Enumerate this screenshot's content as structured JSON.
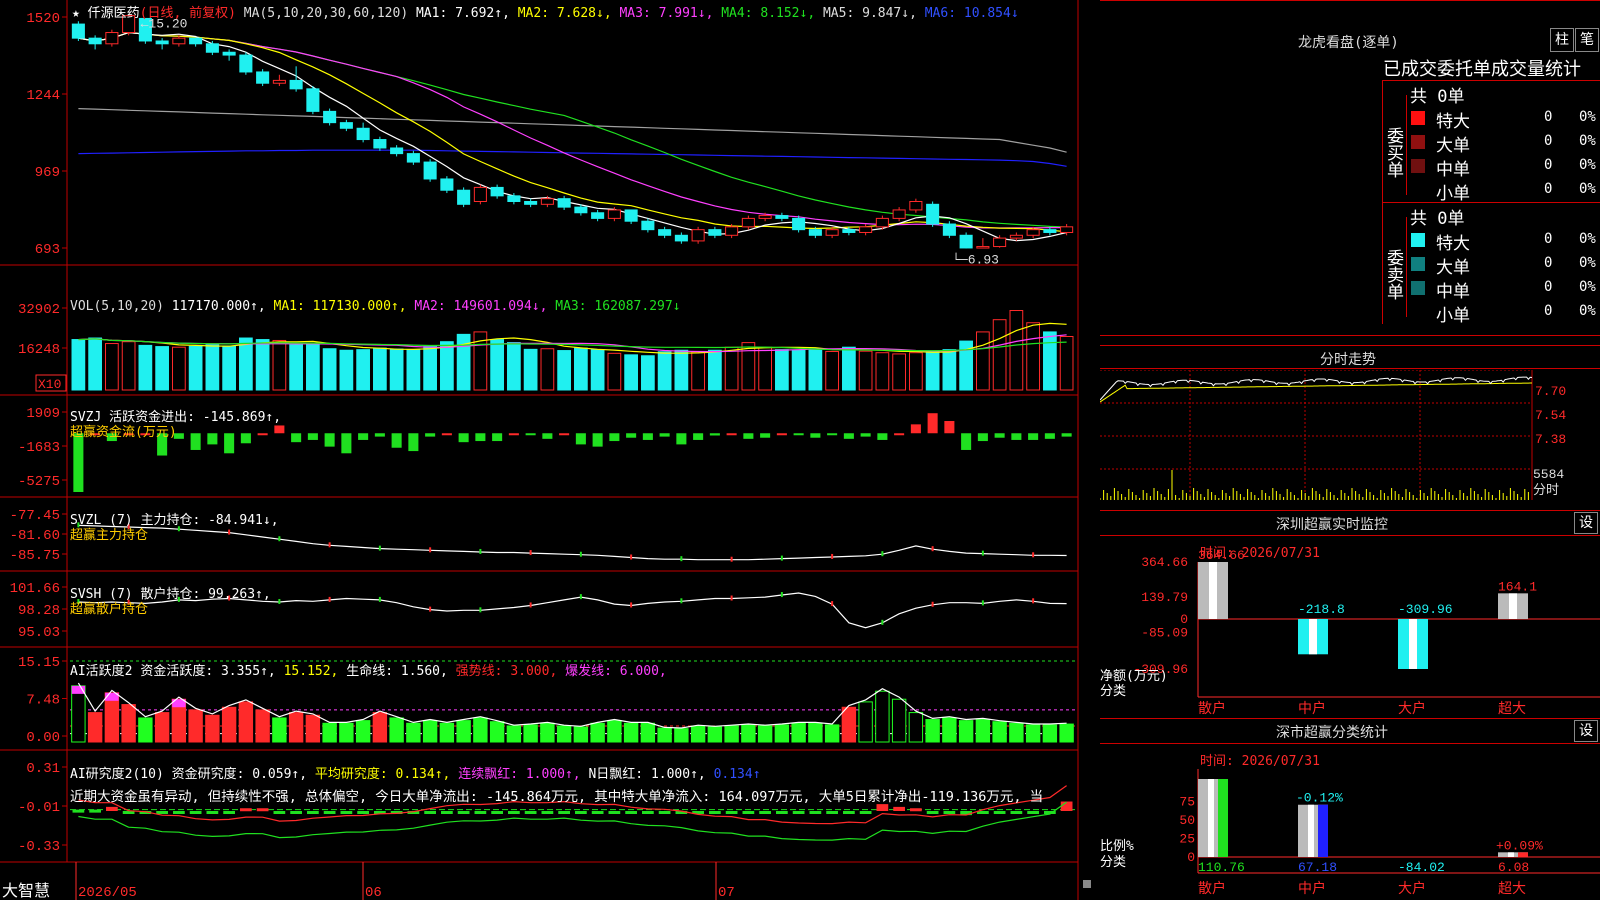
{
  "stock": {
    "name": "★ 仟源医药",
    "mode": "(日线, 前复权)",
    "low_label": "6.93",
    "high_label": "15.20"
  },
  "colors": {
    "up": "#ff2a2a",
    "down": "#20f0f0",
    "bg": "#000000",
    "grid": "#c00000",
    "ma5": "#ffffff",
    "ma10": "#ffff00",
    "ma20": "#ff40ff",
    "ma30": "#20e020",
    "ma60": "#a0a0a0",
    "ma120": "#2020ff",
    "label": "#ffcc00"
  },
  "main": {
    "y_ticks": [
      "1520",
      "1244",
      "969",
      "693"
    ],
    "header": [
      {
        "t": "MA(5,10,20,30,60,120)",
        "c": "#dddddd"
      },
      {
        "t": "MA1: 7.692↑,",
        "c": "#ffffff"
      },
      {
        "t": "MA2: 7.628↓,",
        "c": "#ffff00"
      },
      {
        "t": "MA3: 7.991↓,",
        "c": "#ff40ff"
      },
      {
        "t": "MA4: 8.152↓,",
        "c": "#20e020"
      },
      {
        "t": "MA5: 9.847↓,",
        "c": "#dddddd"
      },
      {
        "t": "MA6: 10.854↓",
        "c": "#3050ff"
      }
    ]
  },
  "vol": {
    "y_ticks": [
      "32902",
      "16248"
    ],
    "multiplier": "X10",
    "header": [
      {
        "t": "VOL(5,10,20)",
        "c": "#dddddd"
      },
      {
        "t": "117170.000↑,",
        "c": "#ffffff"
      },
      {
        "t": "MA1: 117130.000↑,",
        "c": "#ffff00"
      },
      {
        "t": "MA2: 149601.094↓,",
        "c": "#ff40ff"
      },
      {
        "t": "MA3: 162087.297↓",
        "c": "#20e020"
      }
    ]
  },
  "svzj": {
    "y_ticks": [
      "1909",
      "-1683",
      "-5275"
    ],
    "header": [
      {
        "t": "SVZJ  活跃资金进出: -145.869↑,",
        "c": "#ffffff"
      }
    ],
    "sub": "超赢资金流(万元)"
  },
  "svzl": {
    "y_ticks": [
      "-77.45",
      "-81.60",
      "-85.75"
    ],
    "header": [
      {
        "t": "SVZL (7) 主力持仓: -84.941↓,",
        "c": "#ffffff"
      }
    ],
    "sub": "超赢主力持仓"
  },
  "svsh": {
    "y_ticks": [
      "101.66",
      "98.28",
      "95.03"
    ],
    "header": [
      {
        "t": "SVSH (7) 散户持仓: 99.263↑,",
        "c": "#ffffff"
      }
    ],
    "sub": "超赢散户持仓"
  },
  "ai1": {
    "y_ticks": [
      "15.15",
      "7.48",
      "0.00"
    ],
    "header": [
      {
        "t": "AI活跃度2",
        "c": "#ffffff"
      },
      {
        "t": "资金活跃度: 3.355↑,",
        "c": "#ffffff"
      },
      {
        "t": "15.152,",
        "c": "#ffff00"
      },
      {
        "t": "生命线: 1.560,",
        "c": "#ffffff"
      },
      {
        "t": "强势线: 3.000,",
        "c": "#ff2a2a"
      },
      {
        "t": "爆发线: 6.000,",
        "c": "#ff40ff"
      }
    ]
  },
  "ai2": {
    "y_ticks": [
      "0.31",
      "-0.01",
      "-0.33"
    ],
    "header": [
      {
        "t": "AI研究度2(10)",
        "c": "#ffffff"
      },
      {
        "t": "资金研究度: 0.059↑,",
        "c": "#ffffff"
      },
      {
        "t": "平均研究度: 0.134↑,",
        "c": "#ffff00"
      },
      {
        "t": "连续飘红: 1.000↑,",
        "c": "#ff40ff"
      },
      {
        "t": "N日飘红: 1.000↑,",
        "c": "#ffffff"
      },
      {
        "t": "0.134↑",
        "c": "#3050ff"
      }
    ],
    "comment": "近期大资金虽有异动, 但持续性不强, 总体偏空, 今日大单净流出: -145.864万元, 其中特大单净流入: 164.097万元, 大单5日累计净出-119.136万元, 当"
  },
  "xaxis": {
    "brand": "大智慧",
    "labels": [
      "2026/05",
      "06",
      "07"
    ]
  },
  "lhb": {
    "title": "龙虎看盘(逐单)",
    "btn_bar": "柱",
    "btn_list": "笔",
    "subtitle": "已成交委托单成交量统计",
    "buy": {
      "label": "委买单",
      "total": "共 0单",
      "rows": [
        {
          "name": "特大",
          "count": "0",
          "pct": "0%",
          "color": "#ff1010"
        },
        {
          "name": "大单",
          "count": "0",
          "pct": "0%",
          "color": "#901010"
        },
        {
          "name": "中单",
          "count": "0",
          "pct": "0%",
          "color": "#701010"
        },
        {
          "name": "小单",
          "count": "0",
          "pct": "0%",
          "color": "#000000"
        }
      ]
    },
    "sell": {
      "label": "委卖单",
      "total": "共 0单",
      "rows": [
        {
          "name": "特大",
          "count": "0",
          "pct": "0%",
          "color": "#20f0f0"
        },
        {
          "name": "大单",
          "count": "0",
          "pct": "0%",
          "color": "#108080"
        },
        {
          "name": "中单",
          "count": "0",
          "pct": "0%",
          "color": "#107070"
        },
        {
          "name": "小单",
          "count": "0",
          "pct": "0%",
          "color": "#000000"
        }
      ]
    }
  },
  "intraday": {
    "title": "分时走势",
    "y_ticks": [
      "7.70",
      "7.54",
      "7.38"
    ],
    "vol_label": "5584",
    "vol_unit": "分时"
  },
  "monitor": {
    "title": "深圳超赢实时监控",
    "btn": "设",
    "time": "时间: 2026/07/31",
    "y_ticks": [
      "364.66",
      "139.79",
      "0",
      "-85.09",
      "-309.96"
    ],
    "y_unit": "净额(万元)",
    "x_unit": "分类",
    "bars": [
      {
        "cat": "散户",
        "value": 364.66,
        "label": "364.66"
      },
      {
        "cat": "中户",
        "value": -218.8,
        "label": "-218.8"
      },
      {
        "cat": "大户",
        "value": -309.96,
        "label": "-309.96"
      },
      {
        "cat": "超大",
        "value": 164.1,
        "label": "164.1"
      }
    ]
  },
  "classify": {
    "title": "深市超赢分类统计",
    "btn": "设",
    "time": "时间: 2026/07/31",
    "y_ticks": [
      "75",
      "50",
      "25",
      "0"
    ],
    "y_unit": "比例%",
    "x_unit": "分类",
    "bars": [
      {
        "cat": "散户",
        "value": 100,
        "pct": "",
        "amt": "110.76"
      },
      {
        "cat": "中户",
        "value": 67,
        "pct": "-0.12%",
        "amt": "67.18"
      },
      {
        "cat": "大户",
        "value": 0,
        "pct": "",
        "amt": "-84.02"
      },
      {
        "cat": "超大",
        "value": 6,
        "pct": "+0.09%",
        "amt": "6.08"
      }
    ]
  },
  "chart_data": {
    "type": "candlestick",
    "days": 60,
    "x_labels": [
      "2026/05",
      "06",
      "07"
    ],
    "ohlc": [
      [
        14.9,
        14.4,
        15.0,
        14.3
      ],
      [
        14.4,
        14.2,
        14.5,
        14.0
      ],
      [
        14.2,
        14.6,
        14.7,
        14.1
      ],
      [
        14.6,
        15.2,
        15.2,
        14.5
      ],
      [
        15.1,
        14.3,
        15.1,
        14.2
      ],
      [
        14.3,
        14.2,
        14.4,
        14.0
      ],
      [
        14.2,
        14.4,
        14.5,
        14.1
      ],
      [
        14.4,
        14.2,
        14.4,
        14.1
      ],
      [
        14.2,
        13.9,
        14.3,
        13.8
      ],
      [
        13.9,
        13.8,
        14.0,
        13.6
      ],
      [
        13.8,
        13.2,
        13.9,
        13.1
      ],
      [
        13.2,
        12.8,
        13.3,
        12.7
      ],
      [
        12.8,
        12.9,
        13.1,
        12.7
      ],
      [
        12.9,
        12.6,
        13.4,
        12.5
      ],
      [
        12.6,
        11.8,
        12.7,
        11.7
      ],
      [
        11.8,
        11.4,
        11.9,
        11.3
      ],
      [
        11.4,
        11.2,
        11.5,
        11.1
      ],
      [
        11.2,
        10.8,
        11.4,
        10.7
      ],
      [
        10.8,
        10.5,
        10.9,
        10.4
      ],
      [
        10.5,
        10.3,
        10.6,
        10.2
      ],
      [
        10.3,
        10.0,
        10.4,
        9.9
      ],
      [
        10.0,
        9.4,
        10.1,
        9.3
      ],
      [
        9.4,
        9.0,
        9.5,
        8.9
      ],
      [
        9.0,
        8.5,
        9.1,
        8.4
      ],
      [
        8.6,
        9.1,
        9.2,
        8.5
      ],
      [
        9.1,
        8.8,
        9.2,
        8.7
      ],
      [
        8.8,
        8.6,
        8.9,
        8.5
      ],
      [
        8.6,
        8.5,
        8.7,
        8.4
      ],
      [
        8.5,
        8.7,
        8.8,
        8.4
      ],
      [
        8.7,
        8.4,
        8.8,
        8.3
      ],
      [
        8.4,
        8.2,
        8.5,
        8.1
      ],
      [
        8.2,
        8.0,
        8.3,
        7.9
      ],
      [
        8.0,
        8.3,
        8.4,
        7.9
      ],
      [
        8.3,
        7.9,
        8.3,
        7.8
      ],
      [
        7.9,
        7.6,
        8.0,
        7.5
      ],
      [
        7.6,
        7.4,
        7.7,
        7.3
      ],
      [
        7.4,
        7.2,
        7.5,
        7.1
      ],
      [
        7.2,
        7.6,
        7.7,
        7.1
      ],
      [
        7.6,
        7.4,
        7.7,
        7.3
      ],
      [
        7.4,
        7.7,
        7.8,
        7.3
      ],
      [
        7.7,
        8.0,
        8.1,
        7.6
      ],
      [
        8.0,
        8.1,
        8.2,
        7.9
      ],
      [
        8.1,
        8.0,
        8.2,
        7.9
      ],
      [
        8.0,
        7.6,
        8.1,
        7.5
      ],
      [
        7.6,
        7.4,
        7.7,
        7.3
      ],
      [
        7.4,
        7.6,
        7.7,
        7.3
      ],
      [
        7.6,
        7.5,
        7.7,
        7.4
      ],
      [
        7.5,
        7.7,
        7.8,
        7.4
      ],
      [
        7.7,
        8.0,
        8.1,
        7.6
      ],
      [
        8.0,
        8.3,
        8.4,
        7.9
      ],
      [
        8.3,
        8.6,
        8.7,
        8.2
      ],
      [
        8.5,
        7.8,
        8.6,
        7.7
      ],
      [
        7.8,
        7.4,
        7.9,
        7.3
      ],
      [
        7.4,
        6.95,
        7.5,
        6.93
      ],
      [
        7.0,
        7.0,
        7.3,
        6.95
      ],
      [
        7.0,
        7.3,
        7.4,
        6.96
      ],
      [
        7.3,
        7.4,
        7.5,
        7.2
      ],
      [
        7.4,
        7.6,
        7.7,
        7.3
      ],
      [
        7.6,
        7.5,
        7.7,
        7.4
      ],
      [
        7.5,
        7.7,
        7.8,
        7.4
      ]
    ],
    "ma60": [
      11.9,
      11.88,
      11.86,
      11.84,
      11.82,
      11.8,
      11.78,
      11.76,
      11.74,
      11.72,
      11.7,
      11.68,
      11.66,
      11.64,
      11.62,
      11.6,
      11.58,
      11.56,
      11.54,
      11.52,
      11.5,
      11.48,
      11.46,
      11.44,
      11.42,
      11.4,
      11.38,
      11.36,
      11.34,
      11.32,
      11.3,
      11.28,
      11.26,
      11.24,
      11.22,
      11.2,
      11.18,
      11.16,
      11.14,
      11.12,
      11.1,
      11.08,
      11.06,
      11.04,
      11.02,
      11.0,
      10.98,
      10.96,
      10.94,
      10.92,
      10.9,
      10.88,
      10.86,
      10.84,
      10.82,
      10.8,
      10.7,
      10.6,
      10.5,
      10.35
    ],
    "ma120": [
      10.3,
      10.31,
      10.32,
      10.33,
      10.34,
      10.35,
      10.36,
      10.37,
      10.38,
      10.39,
      10.4,
      10.4,
      10.41,
      10.41,
      10.42,
      10.42,
      10.42,
      10.42,
      10.42,
      10.42,
      10.42,
      10.41,
      10.4,
      10.39,
      10.38,
      10.37,
      10.36,
      10.35,
      10.34,
      10.33,
      10.32,
      10.31,
      10.3,
      10.29,
      10.28,
      10.27,
      10.26,
      10.25,
      10.24,
      10.23,
      10.22,
      10.21,
      10.2,
      10.19,
      10.18,
      10.17,
      10.16,
      10.15,
      10.14,
      10.13,
      10.12,
      10.11,
      10.1,
      10.09,
      10.08,
      10.07,
      10.05,
      10.02,
      9.95,
      9.85
    ],
    "volume": [
      16500,
      17000,
      15200,
      15800,
      14600,
      14200,
      14000,
      14300,
      14800,
      14400,
      17000,
      16500,
      16200,
      14800,
      15000,
      13500,
      13000,
      13200,
      13700,
      13400,
      13100,
      14200,
      15800,
      18200,
      19000,
      16500,
      15500,
      13300,
      13500,
      12900,
      13700,
      13200,
      12000,
      11500,
      11200,
      12500,
      13000,
      12500,
      13000,
      14000,
      15500,
      14000,
      13200,
      13000,
      13500,
      12600,
      14000,
      12700,
      12200,
      11800,
      12200,
      12800,
      13200,
      16000,
      19000,
      23000,
      26000,
      22000,
      19000,
      17500
    ],
    "svzj": [
      -5275,
      0,
      -700,
      0,
      0,
      -2000,
      -500,
      -1500,
      -1000,
      -1800,
      -900,
      0,
      700,
      -800,
      -600,
      -1200,
      -1800,
      -600,
      -300,
      -1300,
      -1600,
      -300,
      0,
      -800,
      -700,
      -700,
      0,
      -100,
      -500,
      0,
      -1000,
      -1200,
      -700,
      -400,
      -600,
      -300,
      -1000,
      -600,
      -200,
      0,
      -500,
      -400,
      0,
      -100,
      -400,
      -100,
      -500,
      -300,
      -600,
      0,
      800,
      1800,
      1100,
      -1500,
      -700,
      -400,
      -600,
      -600,
      -500,
      -300
    ],
    "svzl": [
      -79.5,
      -79.6,
      -79.7,
      -79.8,
      -79.9,
      -80.0,
      -80.2,
      -80.4,
      -80.6,
      -80.8,
      -81.2,
      -81.6,
      -82.0,
      -82.4,
      -82.8,
      -83.1,
      -83.3,
      -83.5,
      -83.7,
      -83.8,
      -83.9,
      -84.0,
      -84.1,
      -84.2,
      -84.3,
      -84.4,
      -84.4,
      -84.5,
      -84.6,
      -84.7,
      -84.8,
      -84.9,
      -85.1,
      -85.3,
      -85.5,
      -85.6,
      -85.6,
      -85.7,
      -85.7,
      -85.7,
      -85.7,
      -85.6,
      -85.5,
      -85.4,
      -85.3,
      -85.2,
      -85.1,
      -85.0,
      -84.7,
      -84.0,
      -83.2,
      -83.8,
      -84.2,
      -84.5,
      -84.6,
      -84.7,
      -84.8,
      -84.9,
      -84.9,
      -84.94
    ],
    "svsh": [
      99.5,
      99.4,
      99.5,
      99.4,
      99.3,
      99.5,
      99.8,
      99.7,
      99.9,
      100.0,
      99.8,
      99.6,
      99.5,
      99.7,
      99.6,
      99.8,
      100.0,
      99.9,
      99.8,
      99.4,
      98.8,
      98.4,
      98.2,
      98.3,
      98.3,
      98.5,
      98.7,
      99.0,
      99.4,
      99.8,
      100.2,
      99.8,
      99.2,
      99.0,
      99.3,
      99.5,
      99.6,
      99.8,
      100.0,
      100.0,
      100.1,
      100.2,
      100.5,
      100.8,
      100.3,
      99.2,
      96.5,
      95.8,
      96.5,
      97.8,
      98.6,
      99.1,
      99.4,
      99.4,
      99.3,
      99.6,
      99.8,
      99.6,
      99.3,
      99.263
    ],
    "ai_activity": [
      10.5,
      5.5,
      9.2,
      7.0,
      4.5,
      5.5,
      8.0,
      6.0,
      5.0,
      6.5,
      7.5,
      6.0,
      4.5,
      5.5,
      5.0,
      3.5,
      3.5,
      4.0,
      5.5,
      4.5,
      3.5,
      4.0,
      3.5,
      4.0,
      4.5,
      3.8,
      3.0,
      3.2,
      3.5,
      3.0,
      2.8,
      3.5,
      4.0,
      3.5,
      3.5,
      2.6,
      2.5,
      3.0,
      2.8,
      3.0,
      3.2,
      3.0,
      3.2,
      3.5,
      3.5,
      3.2,
      6.5,
      7.5,
      9.5,
      8.0,
      5.5,
      4.2,
      4.5,
      4.0,
      4.2,
      3.8,
      3.5,
      3.2,
      3.2,
      3.355
    ],
    "ai_research": [
      0,
      0,
      0.02,
      -0.02,
      -0.01,
      -0.02,
      -0.01,
      -0.02,
      -0.02,
      -0.01,
      0.01,
      0.01,
      -0.02,
      -0.02,
      -0.01,
      -0.01,
      -0.01,
      -0.02,
      -0.02,
      -0.03,
      -0.03,
      -0.02,
      -0.01,
      -0.01,
      -0.02,
      -0.02,
      -0.01,
      -0.02,
      -0.02,
      -0.01,
      -0.02,
      -0.02,
      -0.01,
      -0.02,
      -0.02,
      -0.01,
      -0.01,
      -0.02,
      -0.02,
      -0.01,
      -0.02,
      -0.01,
      -0.02,
      -0.02,
      -0.02,
      -0.02,
      -0.01,
      -0.02,
      0.04,
      0.02,
      0.01,
      -0.02,
      -0.02,
      -0.04,
      -0.02,
      -0.01,
      -0.01,
      -0.01,
      -0.01,
      0.059
    ]
  }
}
